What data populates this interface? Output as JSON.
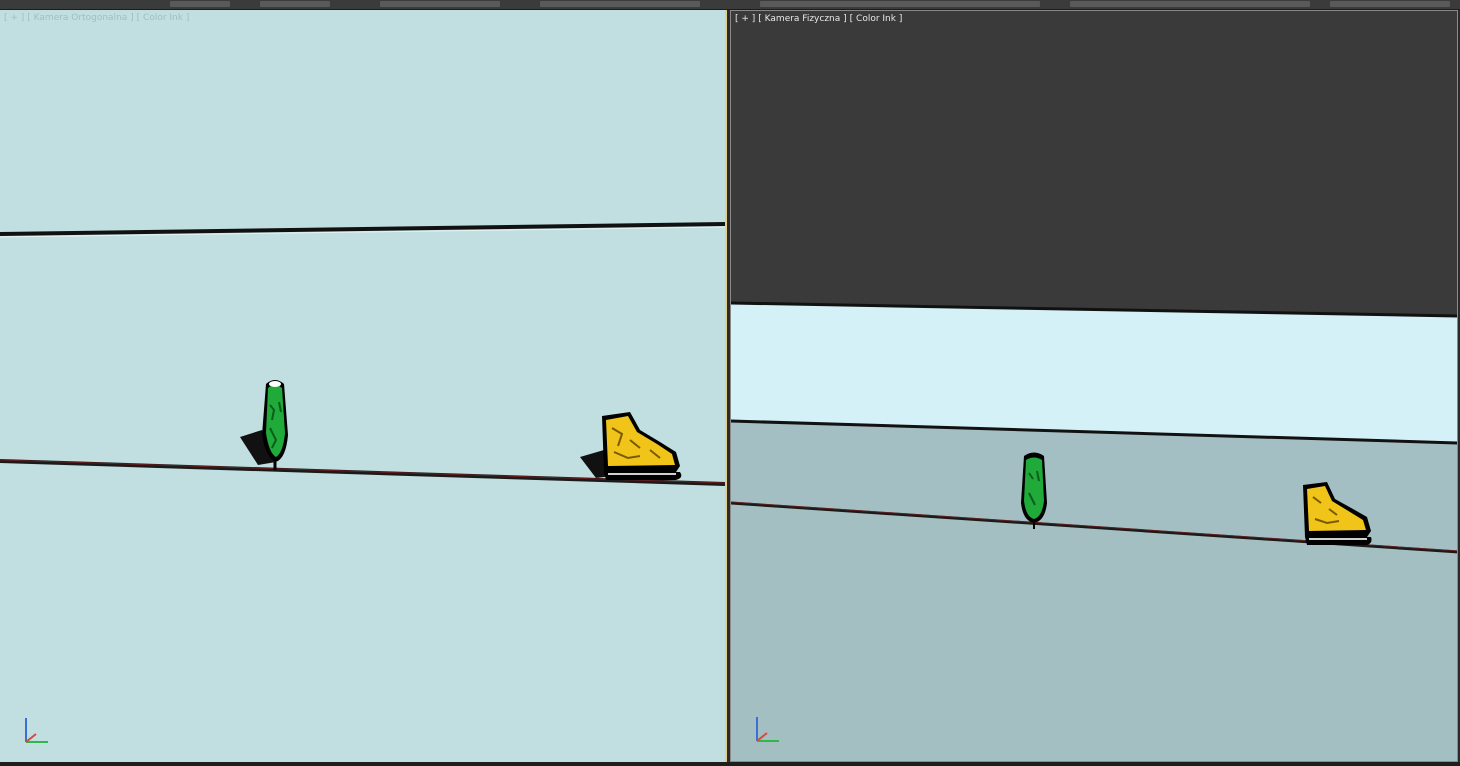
{
  "viewport_left": {
    "label_parts": [
      "[ + ]",
      "[ Kamera Ortogonalna ]",
      "[ Color Ink ]"
    ],
    "background": "#c1dfe0"
  },
  "viewport_right": {
    "label_parts": [
      "[ + ]",
      "[ Kamera Fizyczna ]",
      "[ Color Ink ]"
    ],
    "background": "#3a3a3a"
  },
  "objects": [
    {
      "name": "bottle",
      "color": "#1faa3a"
    },
    {
      "name": "ice-skate",
      "color": "#f0c419"
    }
  ],
  "colors": {
    "accent_border": "#e2d08a",
    "ground_line": "#1a1a1a",
    "axis_x": "#2fb84a",
    "axis_y": "#3a6fd8"
  }
}
